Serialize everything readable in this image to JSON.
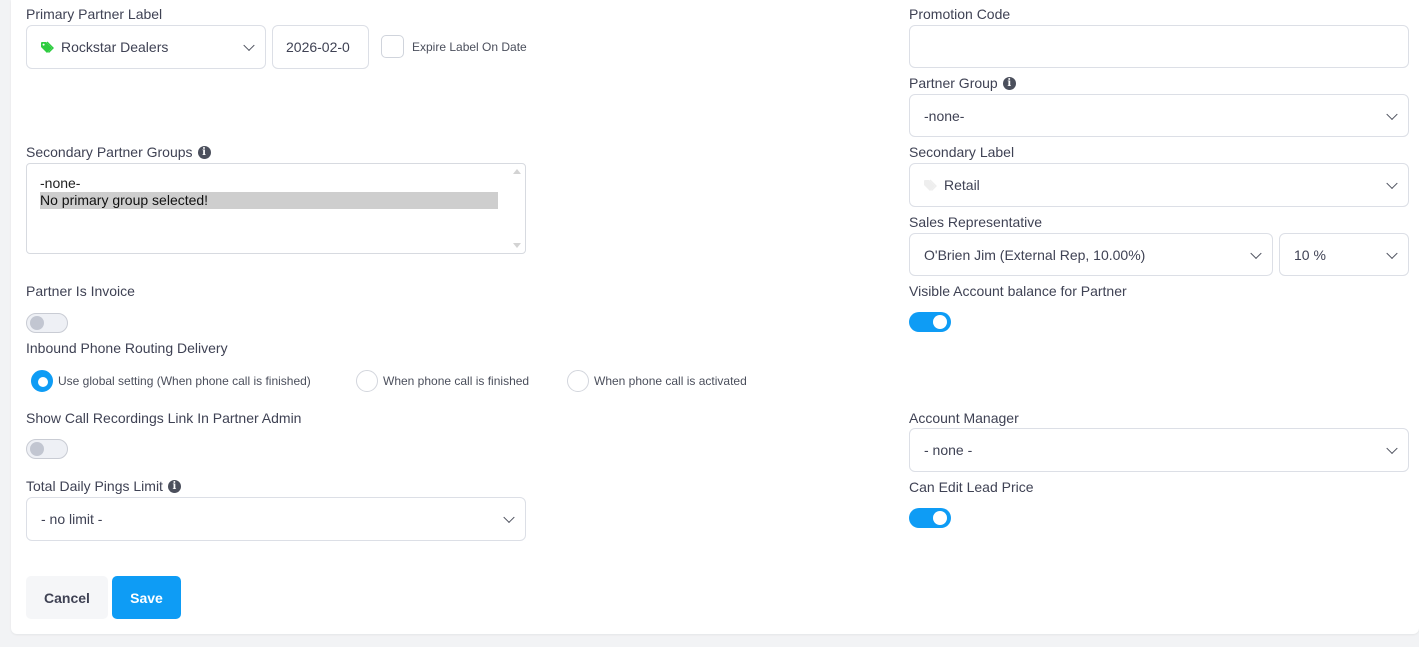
{
  "left": {
    "primary_partner_label": {
      "label": "Primary Partner Label",
      "value": "Rockstar Dealers",
      "icon": "tag-icon",
      "icon_color": "#2ecc40",
      "date_value": "2026-02-0",
      "expire_label": "Expire Label On Date"
    },
    "secondary_partner_groups": {
      "label": "Secondary Partner Groups",
      "options": [
        "-none-",
        "No primary group selected!"
      ]
    },
    "partner_is_invoice": {
      "label": "Partner Is Invoice",
      "on": false
    },
    "inbound_routing": {
      "label": "Inbound Phone Routing Delivery",
      "options": [
        {
          "label": "Use global setting (When phone call is finished)",
          "checked": true
        },
        {
          "label": "When phone call is finished",
          "checked": false
        },
        {
          "label": "When phone call is activated",
          "checked": false
        }
      ]
    },
    "show_call_recordings": {
      "label": "Show Call Recordings Link In Partner Admin",
      "on": false
    },
    "total_daily_pings": {
      "label": "Total Daily Pings Limit",
      "value": "- no limit -"
    }
  },
  "right": {
    "promotion_code": {
      "label": "Promotion Code",
      "value": ""
    },
    "partner_group": {
      "label": "Partner Group",
      "value": "-none-"
    },
    "secondary_label": {
      "label": "Secondary Label",
      "value": "Retail",
      "icon": "tag-icon"
    },
    "sales_rep": {
      "label": "Sales Representative",
      "value": "O'Brien Jim (External Rep, 10.00%)",
      "percent": "10 %"
    },
    "visible_balance": {
      "label": "Visible Account balance for Partner",
      "on": true
    },
    "account_manager": {
      "label": "Account Manager",
      "value": "- none -"
    },
    "can_edit_lead_price": {
      "label": "Can Edit Lead Price",
      "on": true
    }
  },
  "buttons": {
    "cancel": "Cancel",
    "save": "Save"
  },
  "colors": {
    "accent": "#0e9cf5"
  }
}
